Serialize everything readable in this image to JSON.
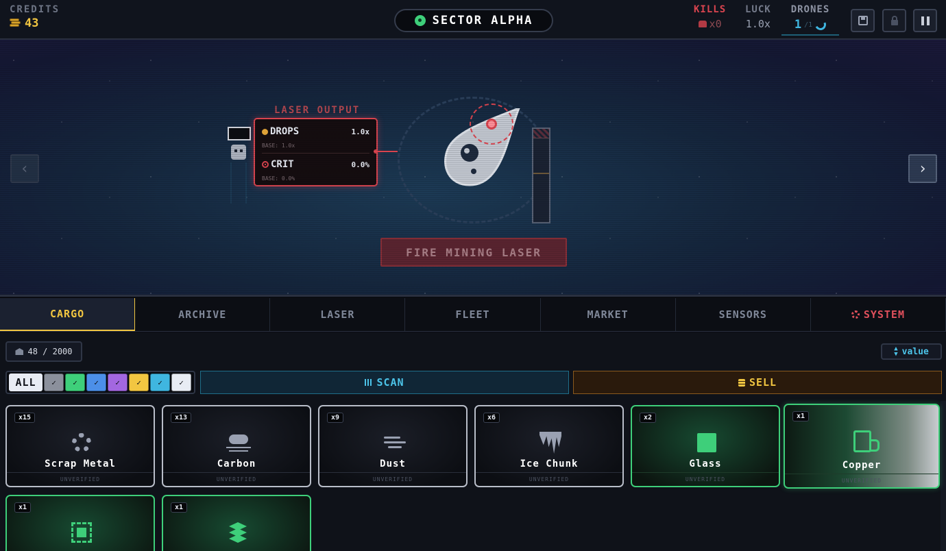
{
  "header": {
    "credits_label": "CREDITS",
    "credits_value": "43",
    "sector_name": "SECTOR ALPHA",
    "kills_label": "KILLS",
    "kills_value": "x0",
    "luck_label": "LUCK",
    "luck_value": "1.0x",
    "drones_label": "DRONES",
    "drones_current": "1",
    "drones_max": "/1",
    "buttons": [
      "save-icon",
      "lock-icon",
      "pause-icon"
    ]
  },
  "scene": {
    "laser_output_label": "LASER OUTPUT",
    "drops_label": "DROPS",
    "drops_value": "1.0x",
    "drops_base": "BASE: 1.0x",
    "crit_label": "CRIT",
    "crit_value": "0.0%",
    "crit_base": "BASE: 0.0%",
    "fire_button": "FIRE MINING LASER",
    "nav_left": "‹",
    "nav_right": "›"
  },
  "tabs": [
    {
      "label": "CARGO",
      "active": true
    },
    {
      "label": "ARCHIVE"
    },
    {
      "label": "LASER"
    },
    {
      "label": "FLEET"
    },
    {
      "label": "MARKET"
    },
    {
      "label": "SENSORS"
    },
    {
      "label": "SYSTEM",
      "icon": "gear-icon"
    }
  ],
  "cargo": {
    "capacity": "48 / 2000",
    "sort_label": "value",
    "filter_all": "ALL",
    "filter_check": "✓",
    "filter_colors": [
      "#8b909c",
      "#3ecf7a",
      "#4c8fe8",
      "#a367e0",
      "#f2c641",
      "#3fb6e0",
      "#e8ecf4"
    ],
    "scan_label": "SCAN",
    "sell_label": "SELL",
    "items": [
      {
        "count": "x15",
        "name": "Scrap Metal",
        "status": "UNVERIFIED",
        "icon": "gear-icon"
      },
      {
        "count": "x13",
        "name": "Carbon",
        "status": "UNVERIFIED",
        "icon": "cloud-icon"
      },
      {
        "count": "x9",
        "name": "Dust",
        "status": "UNVERIFIED",
        "icon": "wind-icon"
      },
      {
        "count": "x6",
        "name": "Ice Chunk",
        "status": "UNVERIFIED",
        "icon": "icicle-icon"
      },
      {
        "count": "x2",
        "name": "Glass",
        "status": "UNVERIFIED",
        "icon": "square-icon"
      },
      {
        "count": "x1",
        "name": "Copper",
        "status": "UNVERIFIED",
        "icon": "charger-icon"
      },
      {
        "count": "x1",
        "icon": "chip-icon"
      },
      {
        "count": "x1",
        "icon": "layers-icon"
      }
    ]
  },
  "colors": {
    "accent_gold": "#f2c641",
    "danger_red": "#d9444f",
    "rare_green": "#3ecf7a",
    "info_cyan": "#4cc3e8"
  }
}
